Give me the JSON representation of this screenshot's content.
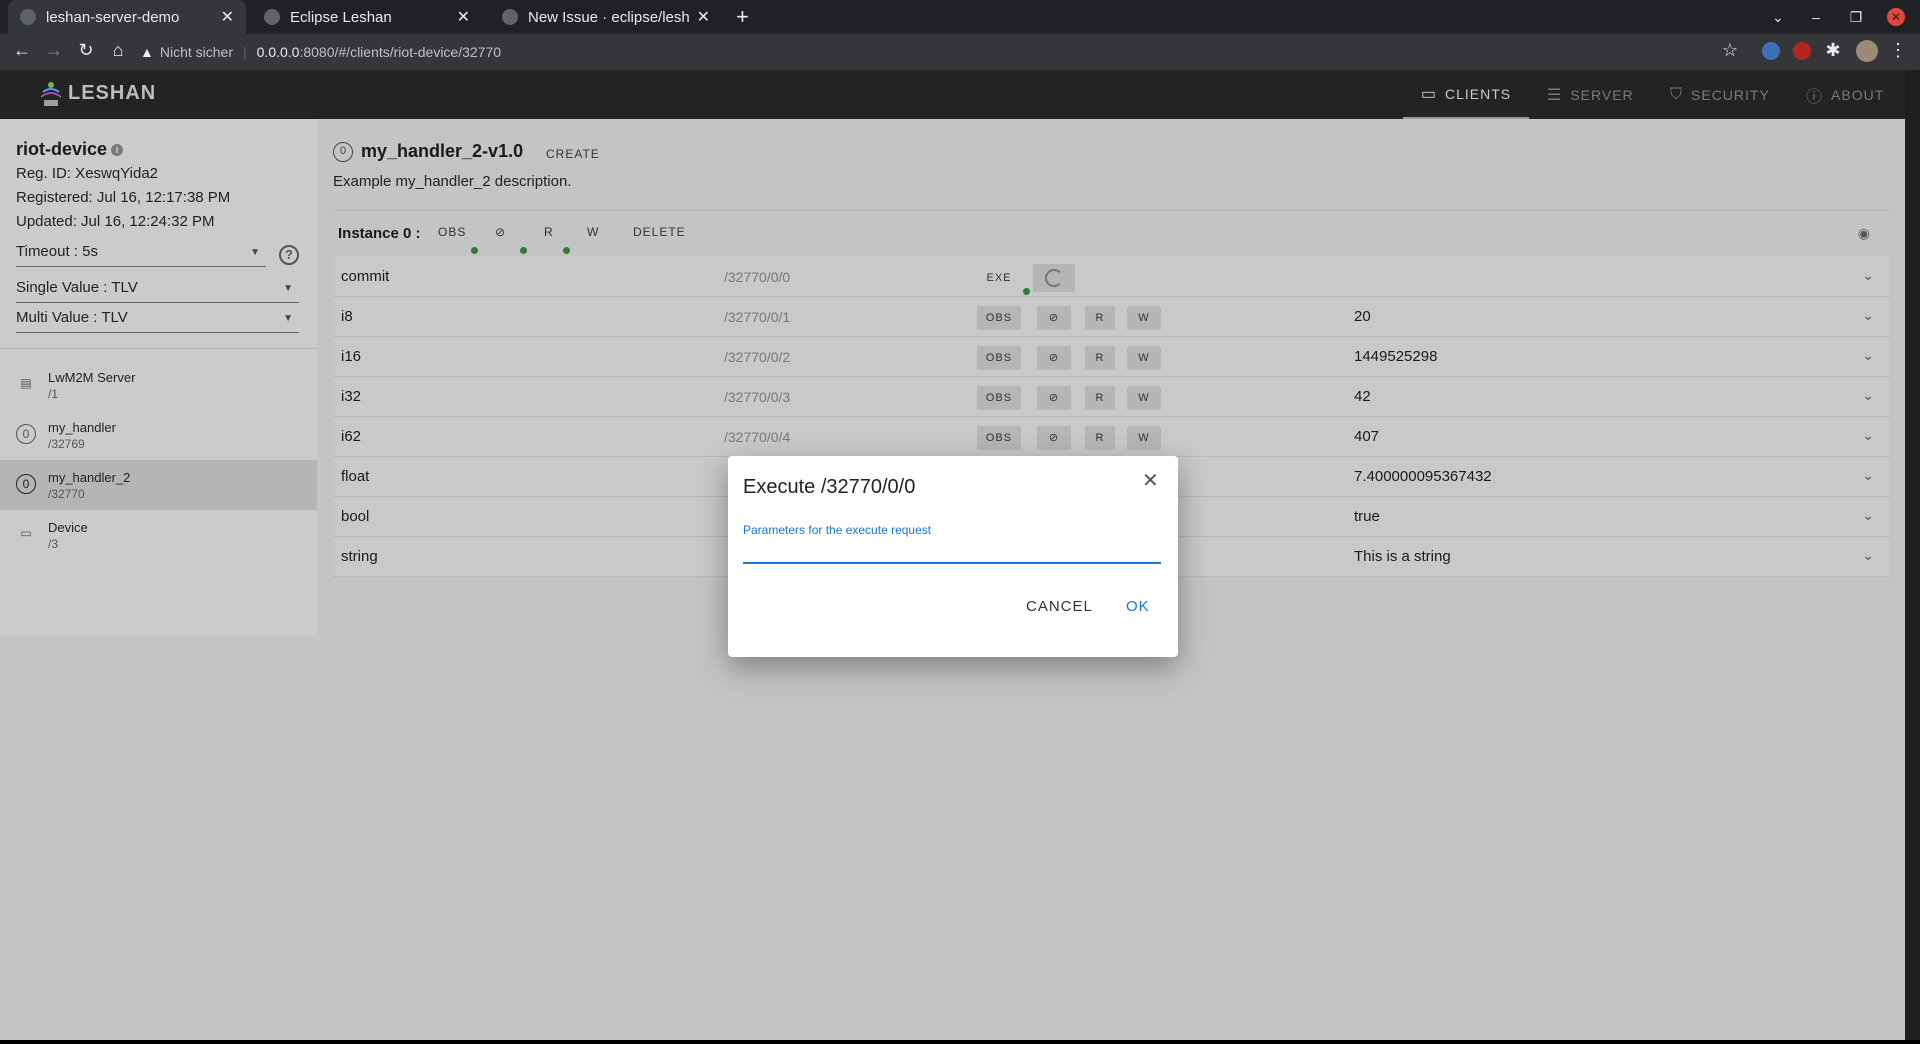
{
  "browser": {
    "tabs": [
      {
        "title": "leshan-server-demo"
      },
      {
        "title": "Eclipse Leshan"
      },
      {
        "title": "New Issue · eclipse/leshan"
      }
    ],
    "url": {
      "security": "Nicht sicher",
      "host": "0.0.0.0",
      "path": ":8080/#/clients/riot-device/32770"
    }
  },
  "app": {
    "logo": "LESHAN",
    "nav": [
      {
        "label": "CLIENTS",
        "icon": "devices-icon"
      },
      {
        "label": "SERVER",
        "icon": "server-icon"
      },
      {
        "label": "SECURITY",
        "icon": "shield-icon"
      },
      {
        "label": "ABOUT",
        "icon": "info-icon"
      }
    ]
  },
  "client": {
    "name": "riot-device",
    "reg_id": "Reg. ID: XeswqYida2",
    "registered": "Registered: Jul 16, 12:17:38 PM",
    "updated": "Updated: Jul 16, 12:24:32 PM",
    "timeout": "Timeout : 5s",
    "single_value": "Single Value : TLV",
    "multi_value": "Multi Value : TLV",
    "help_glyph": "?",
    "objects": [
      {
        "name": "LwM2M Server",
        "id": "/1",
        "icon": "server-icon",
        "glyph": "▤"
      },
      {
        "name": "my_handler",
        "id": "/32769",
        "icon": "custom-object-icon",
        "glyph": "0"
      },
      {
        "name": "my_handler_2",
        "id": "/32770",
        "icon": "custom-object-icon",
        "glyph": "0"
      },
      {
        "name": "Device",
        "id": "/3",
        "icon": "device-icon",
        "glyph": "▭"
      }
    ]
  },
  "object": {
    "icon_glyph": "0",
    "title": "my_handler_2-v1.0",
    "create_label": "CREATE",
    "description": "Example my_handler_2 description.",
    "instance_label": "Instance 0 :",
    "instance_buttons": {
      "obs": "OBS",
      "cancel_obs": "⊘",
      "read": "R",
      "write": "W",
      "delete": "DELETE"
    },
    "eye_glyph": "◉",
    "resources": [
      {
        "name": "commit",
        "path": "/32770/0/0",
        "value": "",
        "type": "exe"
      },
      {
        "name": "i8",
        "path": "/32770/0/1",
        "value": "20",
        "type": "rw"
      },
      {
        "name": "i16",
        "path": "/32770/0/2",
        "value": "1449525298",
        "type": "rw"
      },
      {
        "name": "i32",
        "path": "/32770/0/3",
        "value": "42",
        "type": "rw"
      },
      {
        "name": "i62",
        "path": "/32770/0/4",
        "value": "407",
        "type": "rw"
      },
      {
        "name": "float",
        "path": "",
        "value": "7.400000095367432",
        "type": "rw"
      },
      {
        "name": "bool",
        "path": "",
        "value": "true",
        "type": "rw"
      },
      {
        "name": "string",
        "path": "",
        "value": "This is a string",
        "type": "rw"
      }
    ],
    "row_buttons": {
      "obs": "OBS",
      "read": "R",
      "write": "W",
      "exe": "EXE"
    }
  },
  "dialog": {
    "title": "Execute /32770/0/0",
    "label": "Parameters for the execute request",
    "value": "",
    "cancel": "CANCEL",
    "ok": "OK"
  },
  "colors": {
    "accent": "#1976d2",
    "observe_dot": "#2e7d32",
    "close_button": "#e0483e"
  }
}
